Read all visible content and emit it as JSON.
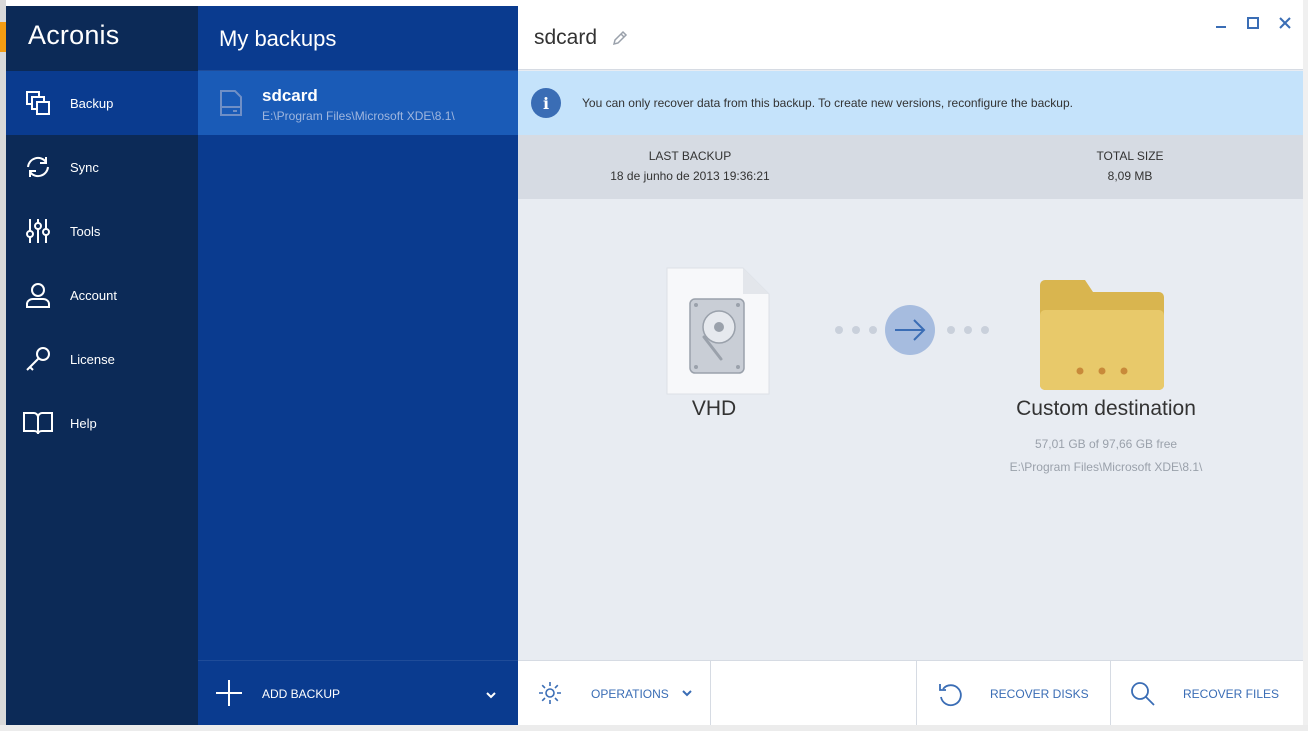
{
  "app": {
    "logo": "Acronis"
  },
  "nav": {
    "items": [
      {
        "label": "Backup",
        "icon": "backup-icon"
      },
      {
        "label": "Sync",
        "icon": "sync-icon"
      },
      {
        "label": "Tools",
        "icon": "tools-icon"
      },
      {
        "label": "Account",
        "icon": "account-icon"
      },
      {
        "label": "License",
        "icon": "key-icon"
      },
      {
        "label": "Help",
        "icon": "book-icon"
      }
    ]
  },
  "backups": {
    "title": "My backups",
    "items": [
      {
        "name": "sdcard",
        "path": "E:\\Program Files\\Microsoft XDE\\8.1\\"
      }
    ],
    "add_label": "ADD BACKUP"
  },
  "main": {
    "title": "sdcard",
    "info_message": "You can only recover data from this backup. To create new versions, reconfigure the backup.",
    "stats": {
      "last_backup_label": "LAST BACKUP",
      "last_backup_value": "18 de junho de 2013 19:36:21",
      "total_size_label": "TOTAL SIZE",
      "total_size_value": "8,09 MB"
    },
    "source": {
      "label": "VHD"
    },
    "destination": {
      "label": "Custom destination",
      "free": "57,01 GB of 97,66 GB free",
      "path": "E:\\Program Files\\Microsoft XDE\\8.1\\"
    },
    "footer": {
      "operations": "OPERATIONS",
      "recover_disks": "RECOVER DISKS",
      "recover_files": "RECOVER FILES"
    }
  },
  "colors": {
    "nav_bg": "#0c2a57",
    "list_bg": "#0a3b8f",
    "selected_bg": "#1a5bb7",
    "info_bg": "#c5e3fb",
    "accent": "#3a6db5",
    "folder": "#e8c96a"
  }
}
